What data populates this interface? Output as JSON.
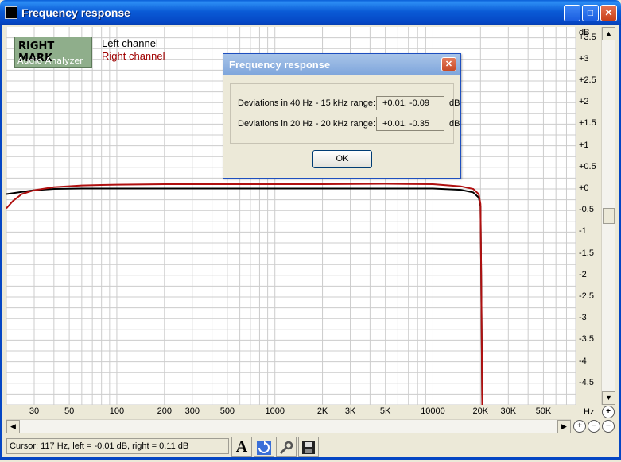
{
  "window": {
    "title": "Frequency response",
    "minimize_glyph": "_",
    "maximize_glyph": "□",
    "close_glyph": "✕"
  },
  "logo": {
    "line1": "RIGHT MARK",
    "line2": "Audio Analyzer"
  },
  "legend": [
    {
      "label": "Left channel",
      "color": "#000000"
    },
    {
      "label": "Right channel",
      "color": "#a00000"
    }
  ],
  "dialog": {
    "title": "Frequency response",
    "close_glyph": "✕",
    "rows": [
      {
        "label": "Deviations in 40 Hz - 15 kHz range:",
        "value": "+0.01, -0.09",
        "unit": "dB"
      },
      {
        "label": "Deviations in 20 Hz - 20 kHz range:",
        "value": "+0.01, -0.35",
        "unit": "dB"
      }
    ],
    "ok_label": "OK"
  },
  "status": {
    "cursor": "Cursor:  117 Hz,  left = -0.01 dB,  right = 0.11 dB"
  },
  "toolbar": {
    "font_glyph": "A",
    "icons": [
      "font-icon",
      "refresh-icon",
      "settings-wrench-icon",
      "save-disk-icon"
    ]
  },
  "colors": {
    "left": "#000000",
    "right": "#b01010",
    "grid": "#cccccc",
    "titlebar": "#0546c4"
  },
  "chart_data": {
    "type": "line",
    "x_scale": "log",
    "xlim": [
      20,
      80000
    ],
    "ylim": [
      -5,
      3.75
    ],
    "y_unit": "dB",
    "x_unit": "Hz",
    "x_ticks": [
      {
        "v": 30,
        "label": "30"
      },
      {
        "v": 50,
        "label": "50"
      },
      {
        "v": 100,
        "label": "100"
      },
      {
        "v": 200,
        "label": "200"
      },
      {
        "v": 300,
        "label": "300"
      },
      {
        "v": 500,
        "label": "500"
      },
      {
        "v": 1000,
        "label": "1000"
      },
      {
        "v": 2000,
        "label": "2K"
      },
      {
        "v": 3000,
        "label": "3K"
      },
      {
        "v": 5000,
        "label": "5K"
      },
      {
        "v": 10000,
        "label": "10000"
      },
      {
        "v": 20000,
        "label": "20K"
      },
      {
        "v": 30000,
        "label": "30K"
      },
      {
        "v": 50000,
        "label": "50K"
      }
    ],
    "y_ticks": [
      {
        "v": 3.5,
        "label": "+3.5"
      },
      {
        "v": 3,
        "label": "+3"
      },
      {
        "v": 2.5,
        "label": "+2.5"
      },
      {
        "v": 2,
        "label": "+2"
      },
      {
        "v": 1.5,
        "label": "+1.5"
      },
      {
        "v": 1,
        "label": "+1"
      },
      {
        "v": 0.5,
        "label": "+0.5"
      },
      {
        "v": 0,
        "label": "+0"
      },
      {
        "v": -0.5,
        "label": "-0.5"
      },
      {
        "v": -1,
        "label": "-1"
      },
      {
        "v": -1.5,
        "label": "-1.5"
      },
      {
        "v": -2,
        "label": "-2"
      },
      {
        "v": -2.5,
        "label": "-2.5"
      },
      {
        "v": -3,
        "label": "-3"
      },
      {
        "v": -3.5,
        "label": "-3.5"
      },
      {
        "v": -4,
        "label": "-4"
      },
      {
        "v": -4.5,
        "label": "-4.5"
      }
    ],
    "grid": true,
    "series": [
      {
        "name": "Left channel",
        "color": "#000000",
        "x": [
          20,
          25,
          30,
          40,
          60,
          100,
          200,
          500,
          1000,
          2000,
          5000,
          10000,
          15000,
          18000,
          19500,
          20000,
          20200,
          20500
        ],
        "y": [
          -0.12,
          -0.07,
          -0.03,
          0.0,
          0.01,
          0.01,
          0.01,
          0.01,
          0.01,
          0.01,
          0.01,
          0.01,
          -0.02,
          -0.08,
          -0.2,
          -0.4,
          -2.0,
          -5.0
        ]
      },
      {
        "name": "Right channel",
        "color": "#b01010",
        "x": [
          20,
          22,
          25,
          30,
          40,
          60,
          100,
          200,
          500,
          1000,
          2000,
          5000,
          10000,
          15000,
          18000,
          19500,
          20000,
          20200,
          20500
        ],
        "y": [
          -0.45,
          -0.28,
          -0.12,
          -0.03,
          0.04,
          0.08,
          0.1,
          0.11,
          0.11,
          0.11,
          0.11,
          0.12,
          0.11,
          0.06,
          0.0,
          -0.12,
          -0.35,
          -2.0,
          -5.0
        ]
      }
    ]
  }
}
